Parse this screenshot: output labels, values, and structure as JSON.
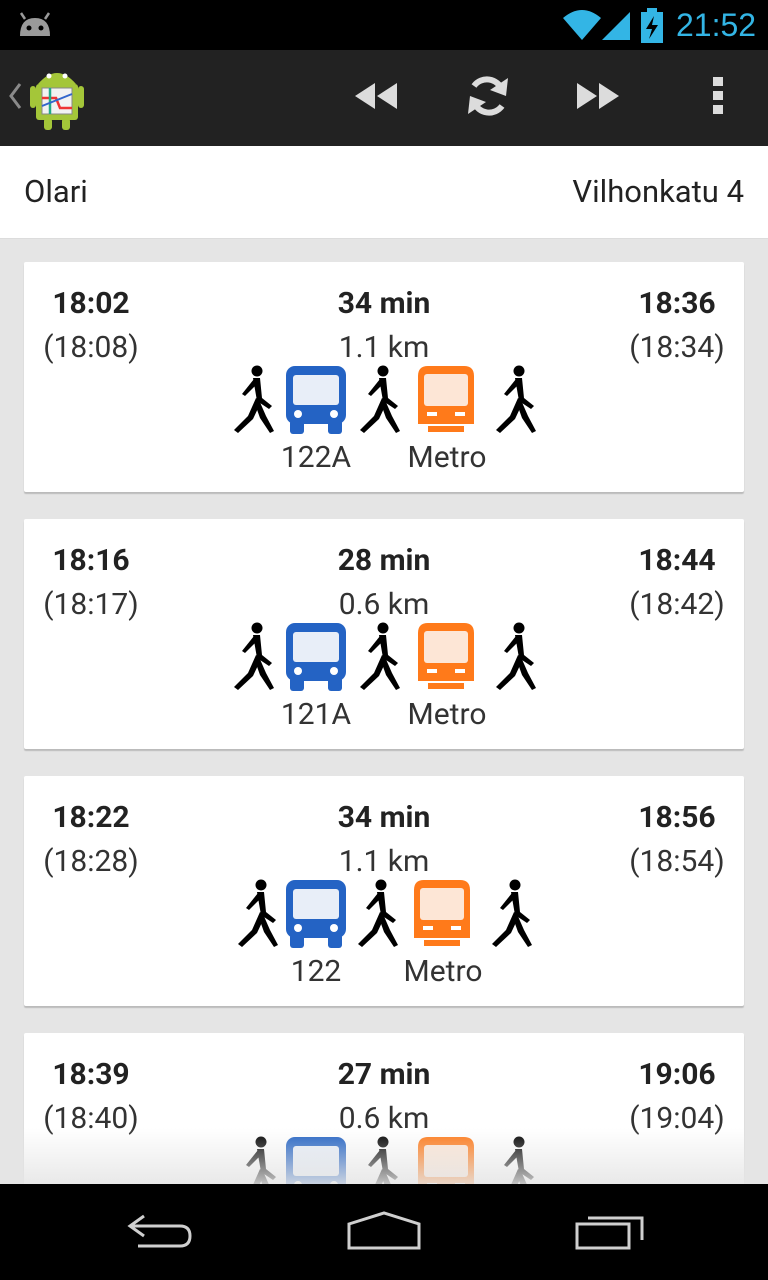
{
  "status_bar": {
    "time": "21:52",
    "icons": [
      "android-debug-icon",
      "wifi-icon",
      "signal-icon",
      "battery-charging-icon"
    ]
  },
  "action_bar": {
    "icons": [
      "up-icon",
      "app-icon",
      "rewind-icon",
      "refresh-icon",
      "fast-forward-icon",
      "overflow-menu-icon"
    ]
  },
  "header": {
    "from": "Olari",
    "to": "Vilhonkatu 4"
  },
  "routes": [
    {
      "depart": "18:02",
      "depart_alt": "(18:08)",
      "duration": "34 min",
      "walk": "1.1 km",
      "arrive": "18:36",
      "arrive_alt": "(18:34)",
      "bus": "122A",
      "metro": "Metro"
    },
    {
      "depart": "18:16",
      "depart_alt": "(18:17)",
      "duration": "28 min",
      "walk": "0.6 km",
      "arrive": "18:44",
      "arrive_alt": "(18:42)",
      "bus": "121A",
      "metro": "Metro"
    },
    {
      "depart": "18:22",
      "depart_alt": "(18:28)",
      "duration": "34 min",
      "walk": "1.1 km",
      "arrive": "18:56",
      "arrive_alt": "(18:54)",
      "bus": "122",
      "metro": "Metro"
    },
    {
      "depart": "18:39",
      "depart_alt": "(18:40)",
      "duration": "27 min",
      "walk": "0.6 km",
      "arrive": "19:06",
      "arrive_alt": "(19:04)",
      "bus": "",
      "metro": ""
    }
  ],
  "colors": {
    "bus": "#2463c4",
    "metro": "#ff7a1a",
    "walk": "#000000",
    "accent": "#33b5e5"
  },
  "nav_bar": {
    "icons": [
      "back-icon",
      "home-icon",
      "recent-apps-icon"
    ]
  }
}
